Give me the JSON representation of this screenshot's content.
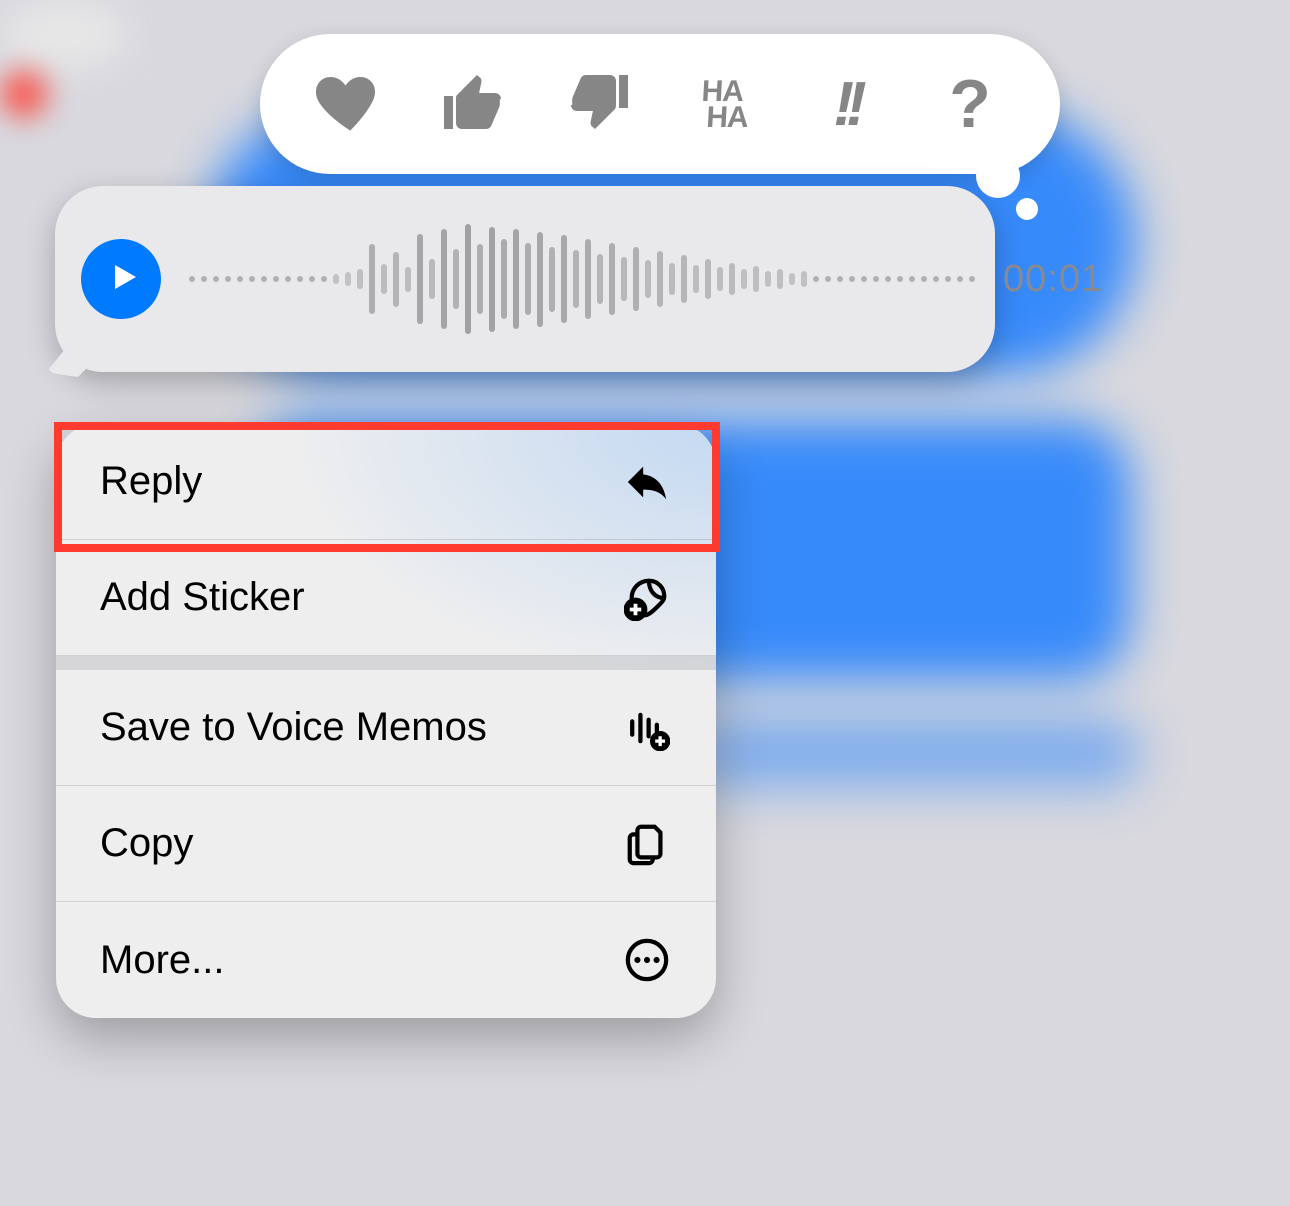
{
  "reactions": [
    {
      "name": "heart"
    },
    {
      "name": "thumbs-up"
    },
    {
      "name": "thumbs-down"
    },
    {
      "name": "haha",
      "label_top": "HA",
      "label_bottom": "HA"
    },
    {
      "name": "emphasize",
      "label": "!!"
    },
    {
      "name": "question",
      "label": "?"
    }
  ],
  "voice_message": {
    "duration": "00:01"
  },
  "menu": {
    "items": [
      {
        "label": "Reply",
        "icon": "reply"
      },
      {
        "label": "Add Sticker",
        "icon": "sticker"
      },
      {
        "label": "Save to Voice Memos",
        "icon": "voicememo"
      },
      {
        "label": "Copy",
        "icon": "copy"
      },
      {
        "label": "More...",
        "icon": "more"
      }
    ]
  },
  "highlight": {
    "item_index": 0
  }
}
